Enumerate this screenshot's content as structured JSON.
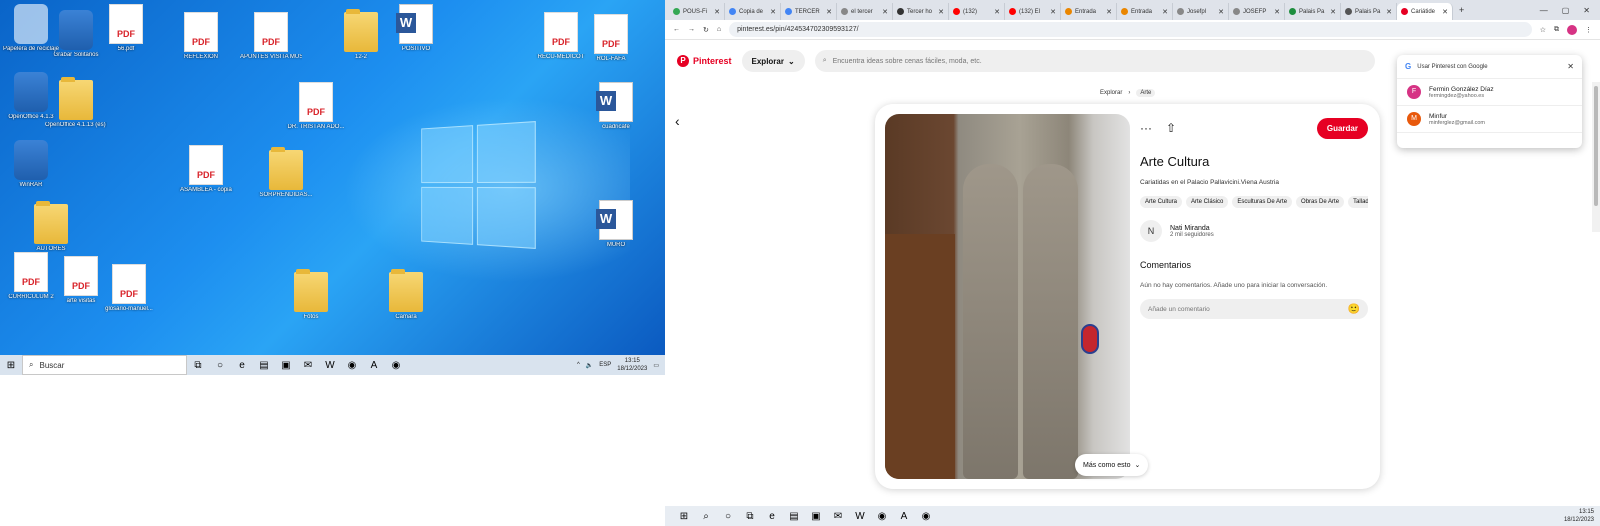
{
  "desktop": {
    "icons": [
      {
        "label": "Papelera de reciclaje",
        "type": "recycle",
        "icon": "recycle-bin-icon"
      },
      {
        "label": "Grabar Solitarios",
        "type": "app",
        "icon": "baseball-glove-icon"
      },
      {
        "label": "56.pdf",
        "type": "pdf",
        "icon": "pdf-icon"
      },
      {
        "label": "REFLEXIÓN",
        "type": "pdf",
        "icon": "pdf-icon"
      },
      {
        "label": "APUNTES VISITA MUSEO ARTE",
        "type": "pdf",
        "icon": "pdf-icon"
      },
      {
        "label": "12-2",
        "type": "folder",
        "icon": "folder-icon"
      },
      {
        "label": "POSITIVO",
        "type": "word",
        "icon": "word-icon"
      },
      {
        "label": "RECU-MEDICOT",
        "type": "pdf",
        "icon": "pdf-icon"
      },
      {
        "label": "ROL-FAFA",
        "type": "pdf",
        "icon": "pdf-icon"
      },
      {
        "label": "OpenOffice 4.1.3",
        "type": "app",
        "icon": "openoffice-icon"
      },
      {
        "label": "OpenOffice 4.1.13 (es) Installation Fi...",
        "type": "folder",
        "icon": "folder-icon"
      },
      {
        "label": "DR. TRISTÁN ADO...",
        "type": "pdf",
        "icon": "pdf-icon"
      },
      {
        "label": "cuadricafe",
        "type": "word",
        "icon": "word-icon"
      },
      {
        "label": "WinRAR",
        "type": "app",
        "icon": "winrar-icon"
      },
      {
        "label": "ASAMBLEA - copia",
        "type": "pdf",
        "icon": "pdf-icon"
      },
      {
        "label": "SORPRENDIDAS...",
        "type": "folder",
        "icon": "folder-icon"
      },
      {
        "label": "AUTORES",
        "type": "folder",
        "icon": "folder-icon"
      },
      {
        "label": "MURO",
        "type": "word",
        "icon": "word-icon"
      },
      {
        "label": "CURRICULUM 2",
        "type": "pdf",
        "icon": "pdf-icon"
      },
      {
        "label": "arte visitas",
        "type": "pdf",
        "icon": "pdf-icon"
      },
      {
        "label": "glosario-manuel...",
        "type": "pdf",
        "icon": "pdf-icon"
      },
      {
        "label": "Fotos",
        "type": "folder",
        "icon": "folder-icon"
      },
      {
        "label": "Camara",
        "type": "folder",
        "icon": "folder-icon"
      }
    ],
    "taskbar": {
      "search_placeholder": "Buscar",
      "icons": [
        "task-view-icon",
        "widgets-icon",
        "edge-icon",
        "explorer-icon",
        "store-icon",
        "mail-icon",
        "word-icon",
        "chrome-icon",
        "acrobat-icon",
        "chrome-icon"
      ],
      "lang": "ESP",
      "time": "13:15",
      "date": "18/12/2023"
    }
  },
  "browser": {
    "tabs": [
      {
        "label": "POUS-Fi",
        "color": "#34a853"
      },
      {
        "label": "Copia de",
        "color": "#4285f4"
      },
      {
        "label": "TERCER",
        "color": "#4285f4"
      },
      {
        "label": "el tercer",
        "color": "#888888"
      },
      {
        "label": "Tercer ho",
        "color": "#333333"
      },
      {
        "label": "(132)",
        "color": "#ff0000"
      },
      {
        "label": "(132) El",
        "color": "#ff0000"
      },
      {
        "label": "Entrada",
        "color": "#ea8600"
      },
      {
        "label": "Entrada",
        "color": "#ea8600"
      },
      {
        "label": "Josefpl",
        "color": "#888888"
      },
      {
        "label": "JOSEFP",
        "color": "#888888"
      },
      {
        "label": "Palais Pa",
        "color": "#1e8e3e"
      },
      {
        "label": "Palais Pa",
        "color": "#555555"
      },
      {
        "label": "Cariátide",
        "color": "#e60023",
        "active": true
      }
    ],
    "url": "pinterest.es/pin/424534702309593127/",
    "pinterest": {
      "logo": "Pinterest",
      "explore": "Explorar",
      "search_placeholder": "Encuentra ideas sobre cenas fáciles, moda, etc.",
      "breadcrumb": [
        "Explorar",
        "Arte"
      ],
      "save": "Guardar",
      "title": "Arte Cultura",
      "description": "Cariatidas en el Palacio Pallavicini.Viena Austria",
      "chips": [
        "Arte Cultura",
        "Arte Clásico",
        "Esculturas De Arte",
        "Obras De Arte",
        "Tallado En"
      ],
      "author_initial": "N",
      "author_name": "Nati Miranda",
      "author_followers": "2  mil seguidores",
      "comments_title": "Comentarios",
      "comments_empty": "Aún no hay comentarios. Añade uno para iniciar la conversación.",
      "comment_placeholder": "Añade un comentario",
      "more_like_this": "Más como esto"
    },
    "google_popup": {
      "title": "Usar Pinterest con Google",
      "accounts": [
        {
          "initial": "F",
          "name": "Fermin González Díaz",
          "email": "fermingdez@yahoo.es",
          "color": "#d63384"
        },
        {
          "initial": "M",
          "name": "Minfur",
          "email": "minferglez@gmail.com",
          "color": "#e8590c"
        }
      ]
    },
    "taskbar": {
      "icons": [
        "start-icon",
        "search-icon",
        "cortana-icon",
        "task-view-icon",
        "edge-icon",
        "explorer-icon",
        "store-icon",
        "mail-icon",
        "word-icon",
        "chrome-icon",
        "acrobat-icon",
        "chrome-icon"
      ],
      "time": "13:15",
      "date": "18/12/2023"
    }
  }
}
